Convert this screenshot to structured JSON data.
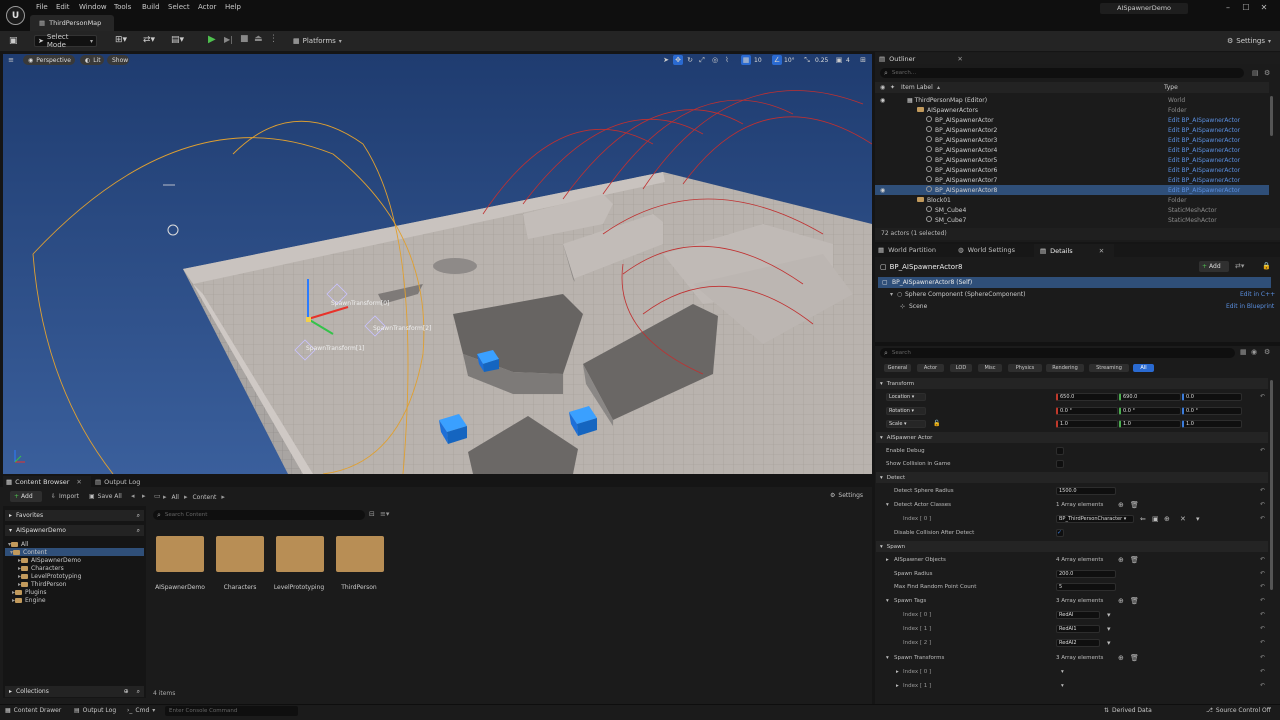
{
  "menu": [
    "File",
    "Edit",
    "Window",
    "Tools",
    "Build",
    "Select",
    "Actor",
    "Help"
  ],
  "document_tab": "ThirdPersonMap",
  "project_name": "AISpawnerDemo",
  "toolbar": {
    "select_mode": "Select Mode",
    "platforms": "Platforms",
    "settings": "Settings"
  },
  "viewport": {
    "perspective": "Perspective",
    "lit": "Lit",
    "show": "Show",
    "grid_snap": "10",
    "rot_snap": "10°",
    "scale_snap": "0.25",
    "cam_speed": "4",
    "labels": [
      "SpawnTransform[0]",
      "SpawnTransform[1]",
      "SpawnTransform[2]"
    ]
  },
  "outliner": {
    "title": "Outliner",
    "search_placeholder": "Search...",
    "col_label": "Item Label",
    "col_type": "Type",
    "rows": [
      {
        "label": "ThirdPersonMap (Editor)",
        "type": "World",
        "kind": "world"
      },
      {
        "label": "AISpawnerActors",
        "type": "Folder",
        "kind": "folder"
      },
      {
        "label": "BP_AISpawnerActor",
        "type": "Edit BP_AISpawnerActor",
        "kind": "actor"
      },
      {
        "label": "BP_AISpawnerActor2",
        "type": "Edit BP_AISpawnerActor",
        "kind": "actor"
      },
      {
        "label": "BP_AISpawnerActor3",
        "type": "Edit BP_AISpawnerActor",
        "kind": "actor"
      },
      {
        "label": "BP_AISpawnerActor4",
        "type": "Edit BP_AISpawnerActor",
        "kind": "actor"
      },
      {
        "label": "BP_AISpawnerActor5",
        "type": "Edit BP_AISpawnerActor",
        "kind": "actor"
      },
      {
        "label": "BP_AISpawnerActor6",
        "type": "Edit BP_AISpawnerActor",
        "kind": "actor"
      },
      {
        "label": "BP_AISpawnerActor7",
        "type": "Edit BP_AISpawnerActor",
        "kind": "actor"
      },
      {
        "label": "BP_AISpawnerActor8",
        "type": "Edit BP_AISpawnerActor",
        "kind": "actor"
      },
      {
        "label": "Block01",
        "type": "Folder",
        "kind": "folder2"
      },
      {
        "label": "SM_Cube4",
        "type": "StaticMeshActor",
        "kind": "mesh"
      },
      {
        "label": "SM_Cube7",
        "type": "StaticMeshActor",
        "kind": "mesh"
      }
    ],
    "footer": "72 actors (1 selected)"
  },
  "details": {
    "tabs": [
      "World Partition",
      "World Settings",
      "Details"
    ],
    "actor_name": "BP_AISpawnerActor8",
    "add_label": "Add",
    "self_label": "BP_AISpawnerActor8 (Self)",
    "sphere_label": "Sphere Component (SphereComponent)",
    "scene_label": "Scene",
    "edit_cpp": "Edit in C++",
    "edit_bp": "Edit in Blueprint",
    "search_placeholder": "Search",
    "filters": [
      "General",
      "Actor",
      "LOD",
      "Misc",
      "Physics",
      "Rendering",
      "Streaming",
      "All"
    ],
    "transform": {
      "category": "Transform",
      "location_label": "Location",
      "location": [
        "650.0",
        "690.0",
        "0.0"
      ],
      "rotation_label": "Rotation",
      "rotation": [
        "0.0 °",
        "0.0 °",
        "0.0 °"
      ],
      "scale_label": "Scale",
      "scale": [
        "1.0",
        "1.0",
        "1.0"
      ]
    },
    "aispawner": {
      "category": "AISpawner Actor",
      "enable_debug": "Enable Debug",
      "show_collision": "Show Collision in Game"
    },
    "detect": {
      "category": "Detect",
      "radius_label": "Detect Sphere Radius",
      "radius": "1500.0",
      "classes_label": "Detect Actor Classes",
      "classes_count": "1 Array elements",
      "index0_label": "Index [ 0 ]",
      "index0": "BP_ThirdPersonCharacter",
      "disable_collision": "Disable Collision After Detect"
    },
    "spawn": {
      "category": "Spawn",
      "objects_label": "AISpawner Objects",
      "objects_count": "4 Array elements",
      "radius_label": "Spawn Radius",
      "radius": "200.0",
      "max_find_label": "Max Find Random Point Count",
      "max_find": "5",
      "tags_label": "Spawn Tags",
      "tags_count": "3 Array elements",
      "tags": [
        {
          "label": "Index [ 0 ]",
          "value": "RedAI"
        },
        {
          "label": "Index [ 1 ]",
          "value": "RedAI1"
        },
        {
          "label": "Index [ 2 ]",
          "value": "RedAI2"
        }
      ],
      "transforms_label": "Spawn Transforms",
      "transforms_count": "3 Array elements",
      "transforms": [
        "Index [ 0 ]",
        "Index [ 1 ]"
      ]
    }
  },
  "content_browser": {
    "tabs": [
      "Content Browser",
      "Output Log"
    ],
    "add": "Add",
    "import": "Import",
    "save_all": "Save All",
    "path": [
      "All",
      "Content"
    ],
    "settings": "Settings",
    "favorites": "Favorites",
    "project": "AISpawnerDemo",
    "search_placeholder": "Search Content",
    "tree": [
      "All",
      "Content",
      "AISpawnerDemo",
      "Characters",
      "LevelPrototyping",
      "ThirdPerson",
      "Plugins",
      "Engine"
    ],
    "folders": [
      "AISpawnerDemo",
      "Characters",
      "LevelPrototyping",
      "ThirdPerson"
    ],
    "collections": "Collections",
    "item_count": "4 items"
  },
  "statusbar": {
    "content_drawer": "Content Drawer",
    "output_log": "Output Log",
    "cmd": "Cmd",
    "console_placeholder": "Enter Console Command",
    "derived_data": "Derived Data",
    "source_control": "Source Control Off"
  }
}
